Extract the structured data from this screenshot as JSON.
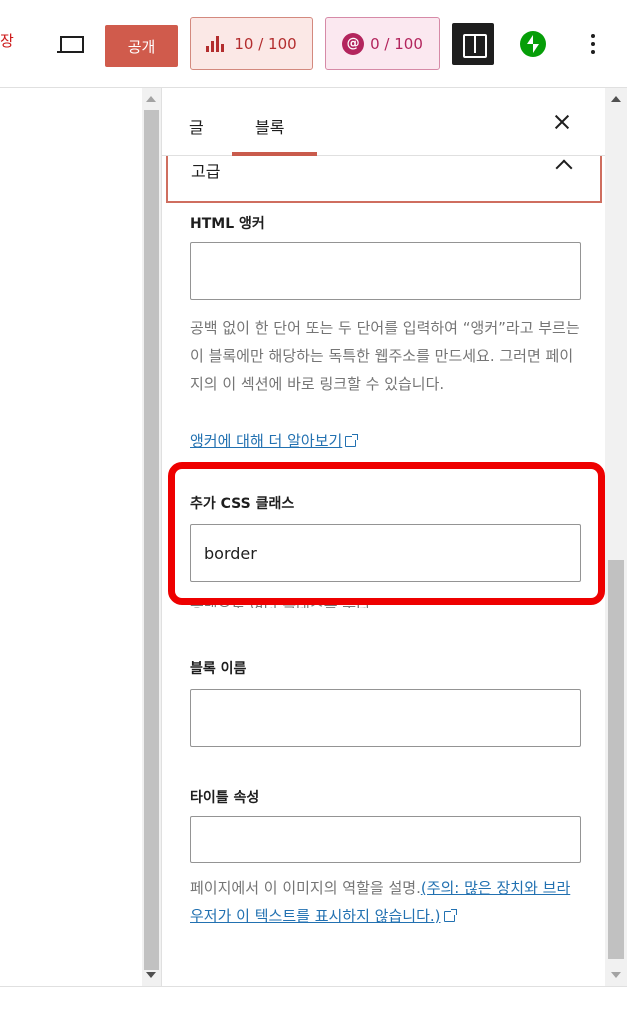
{
  "toolbar": {
    "cut_label": "장",
    "publish_label": "공개",
    "seo_score": "10 / 100",
    "readability_score": "0 / 100",
    "readability_glyph": "@"
  },
  "sidebar": {
    "tabs": [
      {
        "label": "글"
      },
      {
        "label": "블록"
      }
    ],
    "section_title": "고급",
    "html_anchor": {
      "label": "HTML 앵커",
      "value": "",
      "help": "공백 없이 한 단어 또는 두 단어를 입력하여 “앵커”라고 부르는 이 블록에만 해당하는 독특한 웹주소를 만드세요. 그러면 페이지의 이 섹션에 바로 링크할 수 있습니다.",
      "link": "앵커에 대해 더 알아보기"
    },
    "css_class": {
      "label": "추가 CSS 클래스",
      "value": "border",
      "help_clipped": "공백으로 여러 클래스를 분리."
    },
    "block_name": {
      "label": "블록 이름",
      "value": ""
    },
    "title_attr": {
      "label": "타이틀 속성",
      "value": "",
      "help": "페이지에서 이 이미지의 역할을 설명.",
      "link": "(주의: 많은 장치와 브라우저가 이 텍스트를 표시하지 않습니다.)"
    }
  },
  "colors": {
    "accent": "#c95b4c",
    "annotation": "#ee0000",
    "link": "#2271b1",
    "jetpack": "#069e08"
  }
}
